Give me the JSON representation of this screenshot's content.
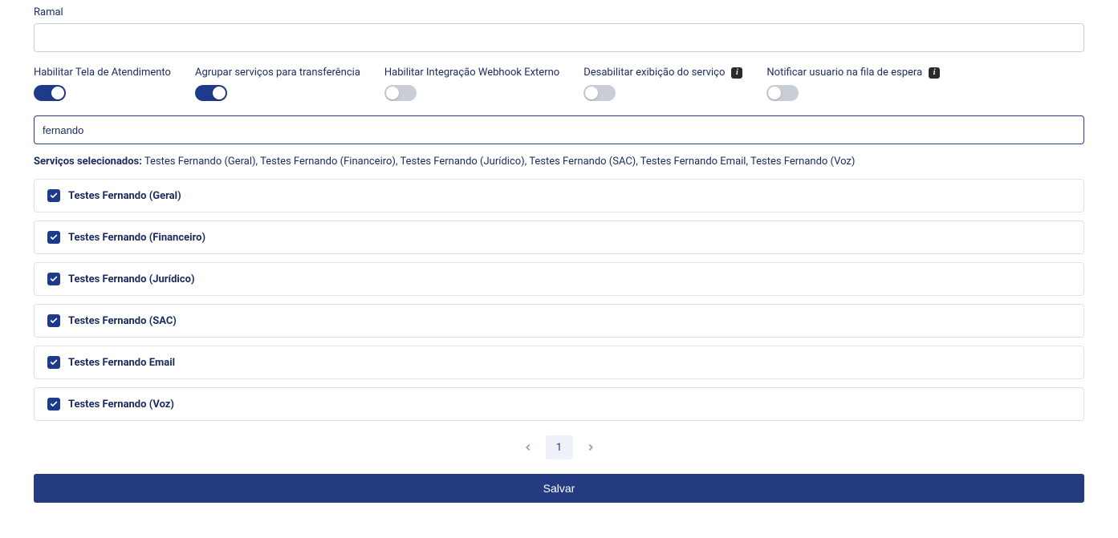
{
  "ramal": {
    "label": "Ramal",
    "value": ""
  },
  "toggles": [
    {
      "label": "Habilitar Tela de Atendimento",
      "on": true,
      "info": false
    },
    {
      "label": "Agrupar serviços para transferência",
      "on": true,
      "info": false
    },
    {
      "label": "Habilitar Integração Webhook Externo",
      "on": false,
      "info": false
    },
    {
      "label": "Desabilitar exibição do serviço",
      "on": false,
      "info": true
    },
    {
      "label": "Notificar usuario na fila de espera",
      "on": false,
      "info": true
    }
  ],
  "search": {
    "value": "fernando"
  },
  "selected": {
    "label": "Serviços selecionados:",
    "value": "Testes Fernando (Geral), Testes Fernando (Financeiro), Testes Fernando (Jurídico), Testes Fernando (SAC), Testes Fernando Email, Testes Fernando (Voz)"
  },
  "services": [
    {
      "name": "Testes Fernando (Geral)",
      "checked": true
    },
    {
      "name": "Testes Fernando (Financeiro)",
      "checked": true
    },
    {
      "name": "Testes Fernando (Jurídico)",
      "checked": true
    },
    {
      "name": "Testes Fernando (SAC)",
      "checked": true
    },
    {
      "name": "Testes Fernando Email",
      "checked": true
    },
    {
      "name": "Testes Fernando (Voz)",
      "checked": true
    }
  ],
  "pagination": {
    "current": "1"
  },
  "save": {
    "label": "Salvar"
  },
  "colors": {
    "primary": "#1e3a8a",
    "button": "#243b82",
    "toggleOff": "#c9cdd6",
    "border": "#dfe2ea",
    "text": "#1a2b5f"
  }
}
